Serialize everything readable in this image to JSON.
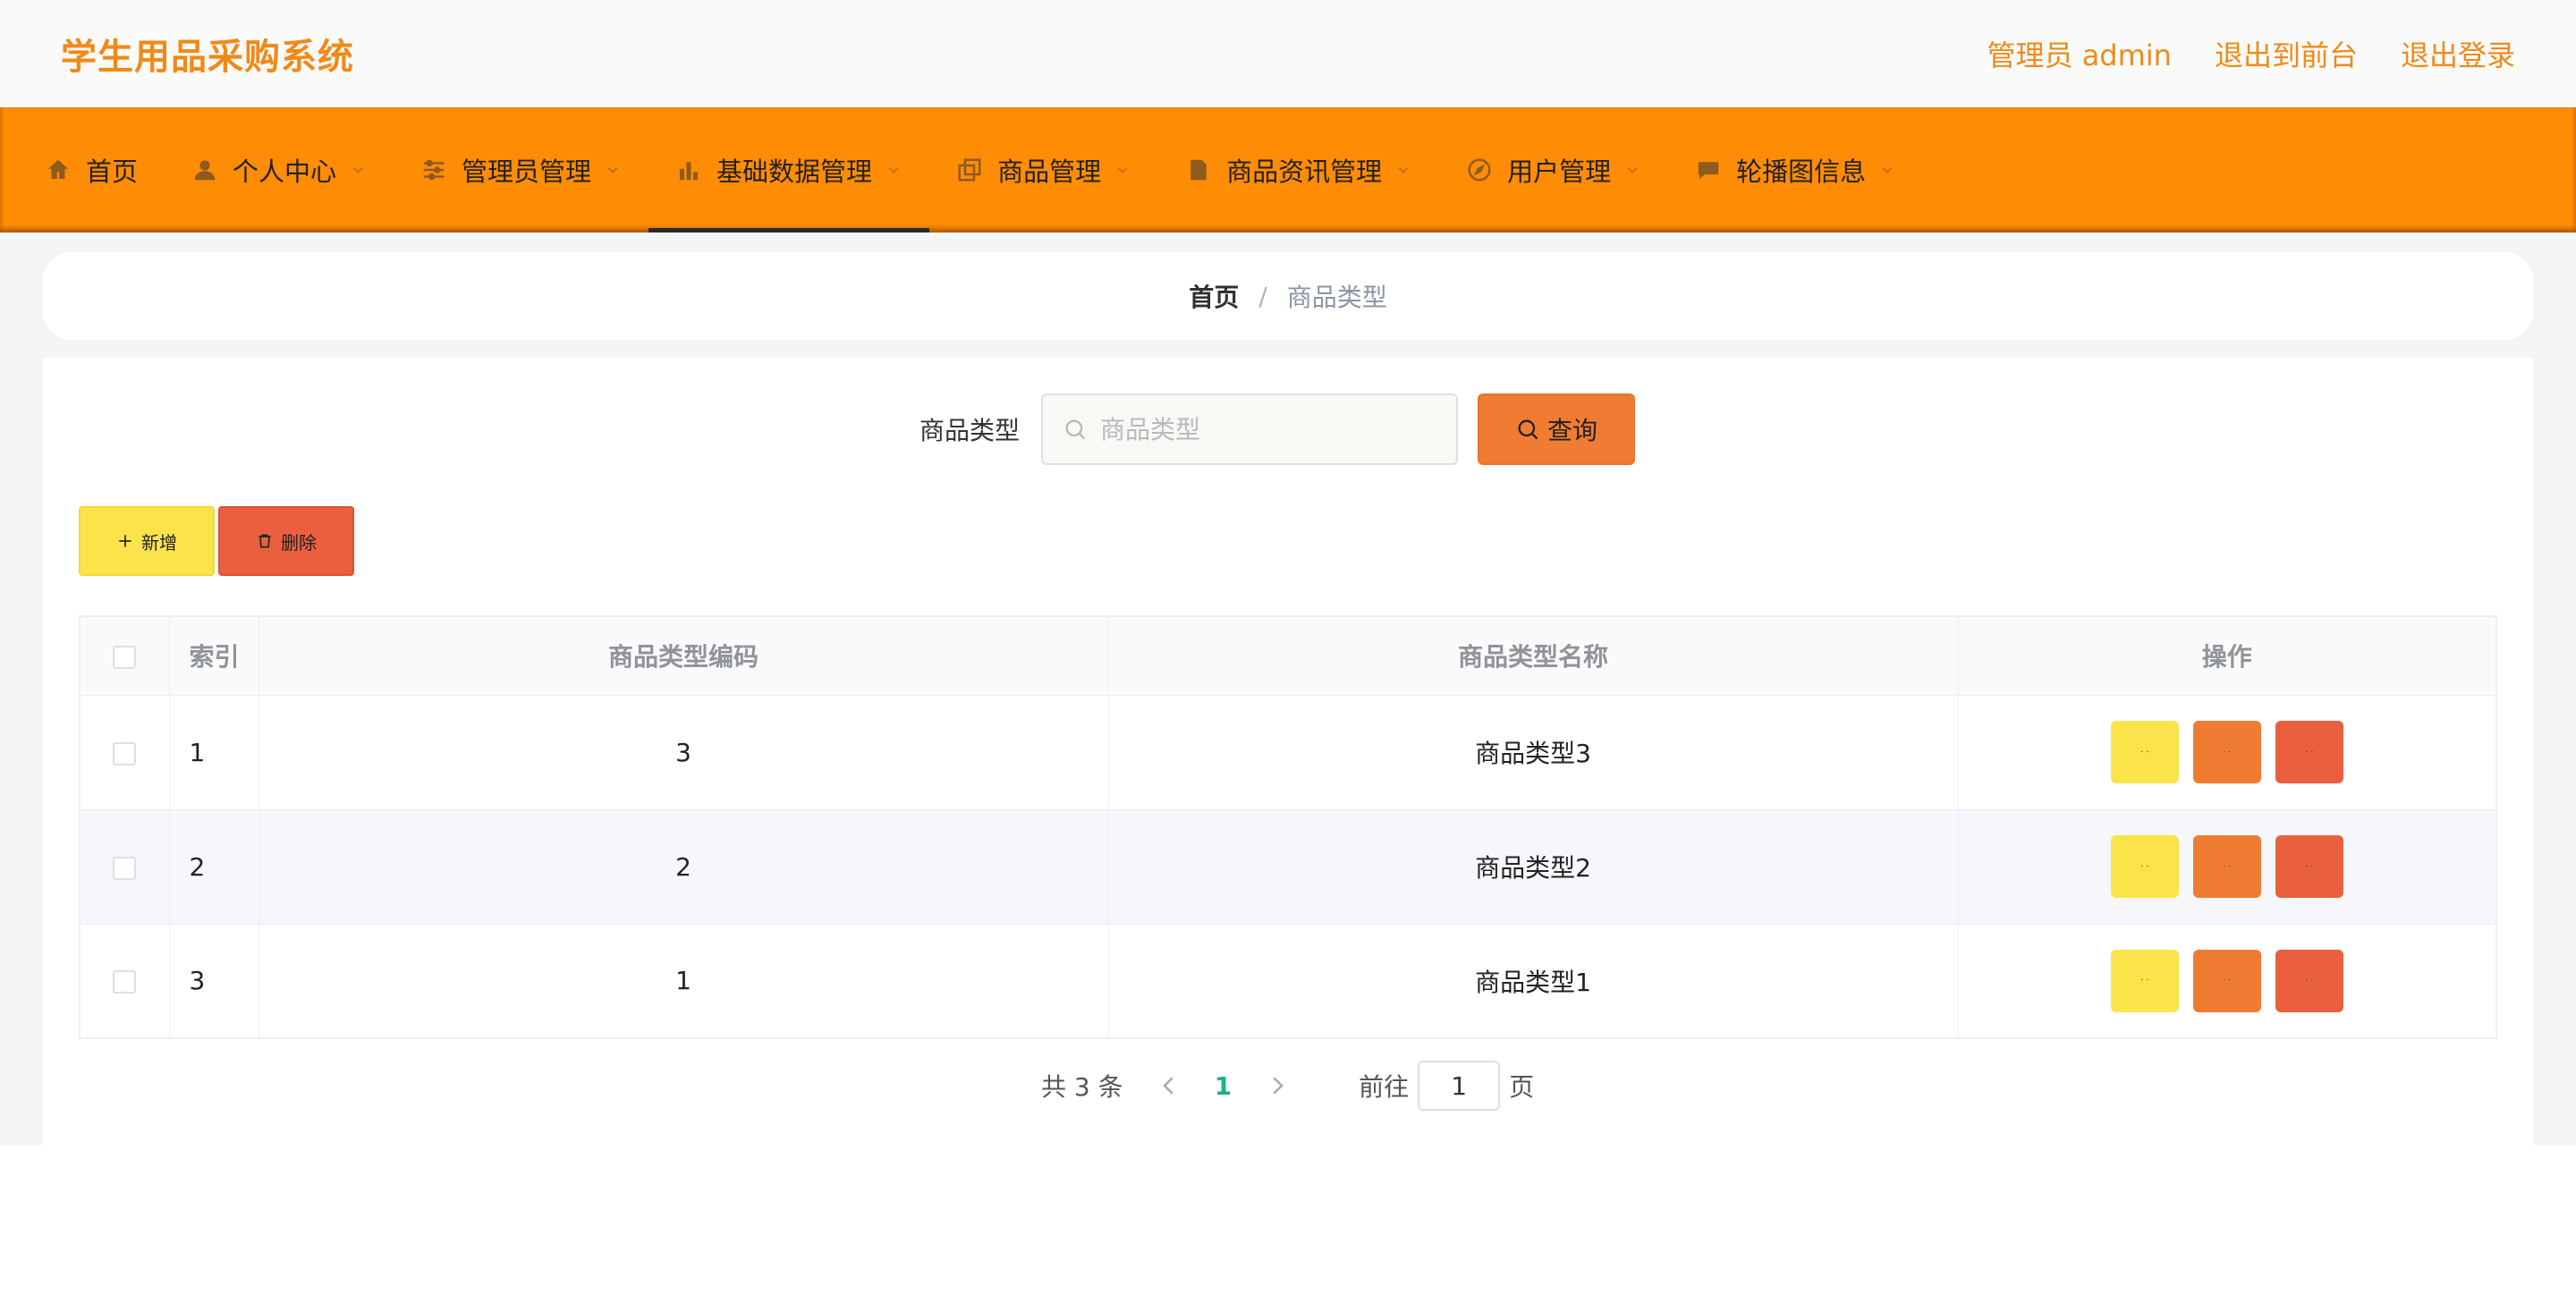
{
  "header": {
    "brand": "学生用品采购系统",
    "admin_label": "管理员 admin",
    "to_front": "退出到前台",
    "logout": "退出登录"
  },
  "nav": [
    {
      "label": "首页",
      "icon": "home-icon",
      "chevron": false,
      "active": false
    },
    {
      "label": "个人中心",
      "icon": "user-icon",
      "chevron": true,
      "active": false
    },
    {
      "label": "管理员管理",
      "icon": "sliders-icon",
      "chevron": true,
      "active": false
    },
    {
      "label": "基础数据管理",
      "icon": "bar-chart-icon",
      "chevron": true,
      "active": true
    },
    {
      "label": "商品管理",
      "icon": "copy-icon",
      "chevron": true,
      "active": false
    },
    {
      "label": "商品资讯管理",
      "icon": "document-icon",
      "chevron": true,
      "active": false
    },
    {
      "label": "用户管理",
      "icon": "compass-icon",
      "chevron": true,
      "active": false
    },
    {
      "label": "轮播图信息",
      "icon": "chat-icon",
      "chevron": true,
      "active": false
    }
  ],
  "breadcrumb": {
    "home": "首页",
    "separator": "/",
    "current": "商品类型"
  },
  "search": {
    "label": "商品类型",
    "placeholder": "商品类型",
    "button": "查询"
  },
  "actions": {
    "add": "新增",
    "delete": "删除"
  },
  "table": {
    "headers": {
      "index": "索引",
      "code": "商品类型编码",
      "name": "商品类型名称",
      "ops": "操作"
    },
    "rows": [
      {
        "index": "1",
        "code": "3",
        "name": "商品类型3"
      },
      {
        "index": "2",
        "code": "2",
        "name": "商品类型2"
      },
      {
        "index": "3",
        "code": "1",
        "name": "商品类型1"
      }
    ]
  },
  "pagination": {
    "total": "共 3 条",
    "current": "1",
    "goto_prefix": "前往",
    "goto_value": "1",
    "goto_suffix": "页"
  },
  "colors": {
    "brand": "#f08a17",
    "nav_bg": "#ff8c05",
    "btn_yellow": "#fbe34c",
    "btn_orange": "#f07c33",
    "btn_red": "#ea603f",
    "page_active": "#17b38a"
  }
}
